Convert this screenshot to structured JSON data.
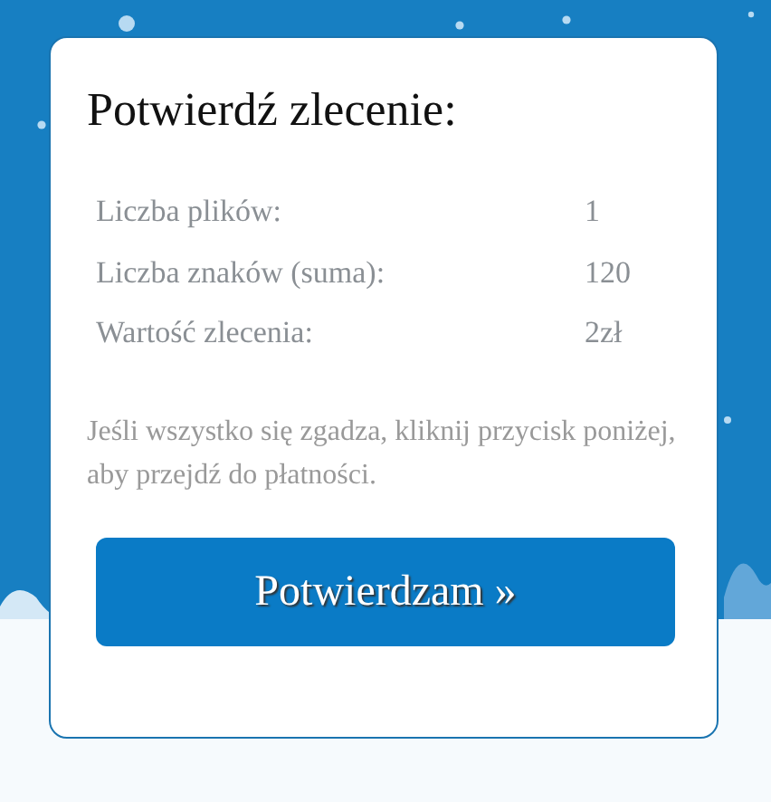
{
  "title": "Potwierdź zlecenie:",
  "summary": [
    {
      "label": "Liczba plików:",
      "value": "1"
    },
    {
      "label": "Liczba znaków (suma):",
      "value": "120"
    },
    {
      "label": "Wartość zlecenia:",
      "value": "2zł"
    }
  ],
  "note": "Jeśli wszystko się zgadza, kliknij przycisk poniżej, aby przejdź do płatności.",
  "button": "Potwierdzam »"
}
